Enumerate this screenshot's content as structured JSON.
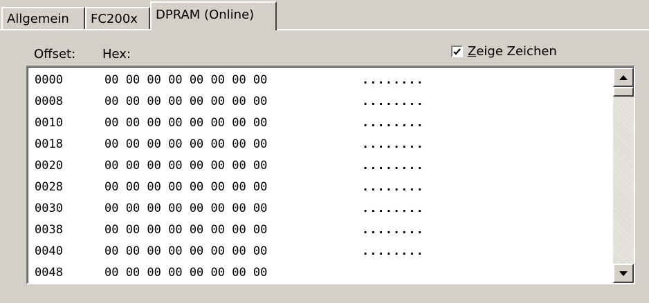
{
  "tabs": [
    {
      "label": "Allgemein",
      "active": false
    },
    {
      "label": "FC200x",
      "active": false
    },
    {
      "label": "DPRAM (Online)",
      "active": true
    }
  ],
  "header": {
    "offset_label": "Offset:",
    "hex_label": "Hex:",
    "show_chars": {
      "label_accel": "Z",
      "label_rest": "eige Zeichen",
      "checked": true
    }
  },
  "rows": [
    {
      "offset": "0000",
      "hex": "00 00 00 00 00 00 00 00",
      "chars": "........"
    },
    {
      "offset": "0008",
      "hex": "00 00 00 00 00 00 00 00",
      "chars": "........"
    },
    {
      "offset": "0010",
      "hex": "00 00 00 00 00 00 00 00",
      "chars": "........"
    },
    {
      "offset": "0018",
      "hex": "00 00 00 00 00 00 00 00",
      "chars": "........"
    },
    {
      "offset": "0020",
      "hex": "00 00 00 00 00 00 00 00",
      "chars": "........"
    },
    {
      "offset": "0028",
      "hex": "00 00 00 00 00 00 00 00",
      "chars": "........"
    },
    {
      "offset": "0030",
      "hex": "00 00 00 00 00 00 00 00",
      "chars": "........"
    },
    {
      "offset": "0038",
      "hex": "00 00 00 00 00 00 00 00",
      "chars": "........"
    },
    {
      "offset": "0040",
      "hex": "00 00 00 00 00 00 00 00",
      "chars": "........"
    },
    {
      "offset": "0048",
      "hex": "00 00 00 00 00 00 00 00",
      "chars": ""
    }
  ],
  "icons": {
    "scroll_up": "arrow-up-icon",
    "scroll_down": "arrow-down-icon",
    "checkmark": "checkmark-icon"
  },
  "colors": {
    "dialog_bg": "#d4d0c8",
    "list_bg": "#ffffff"
  }
}
